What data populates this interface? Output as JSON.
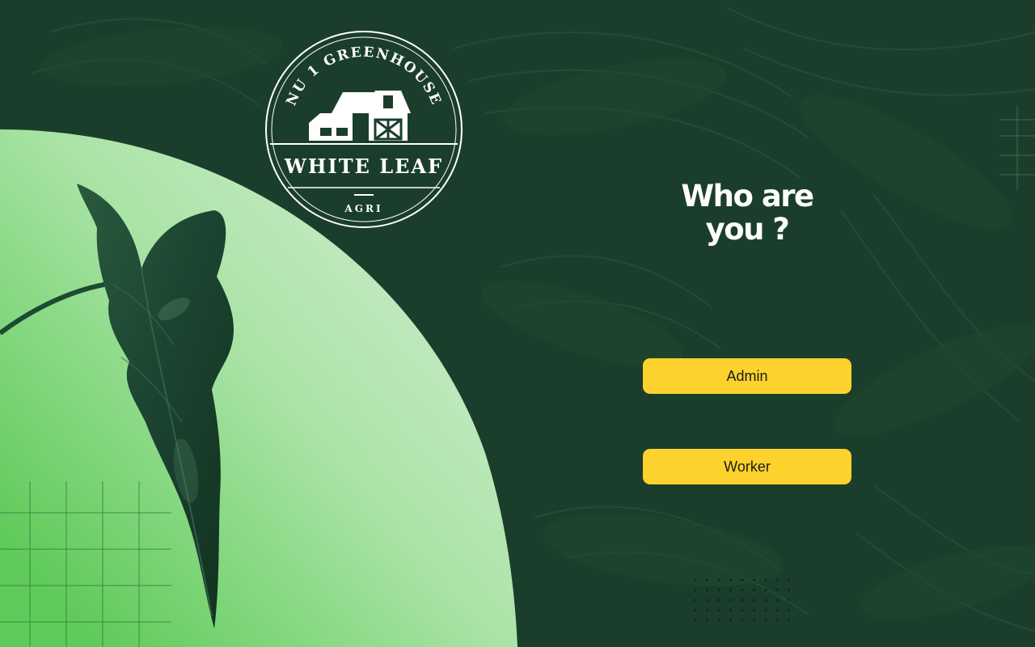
{
  "logo": {
    "top_arc_text": "NU 1 GREENHOUSE",
    "name": "WHITE LEAF",
    "sub": "AGRI"
  },
  "heading": {
    "line1": "Who are",
    "line2": "you ?"
  },
  "roles": {
    "admin_label": "Admin",
    "worker_label": "Worker"
  },
  "colors": {
    "background": "#1b3e2c",
    "arc_light": "#c6ebc7",
    "arc_dark": "#5fcb5a",
    "button": "#fdd22c",
    "leaf": "#1e4a32"
  },
  "icons": {
    "logo_emblem": "barn-icon",
    "decor_leaf": "leaf-icon"
  }
}
